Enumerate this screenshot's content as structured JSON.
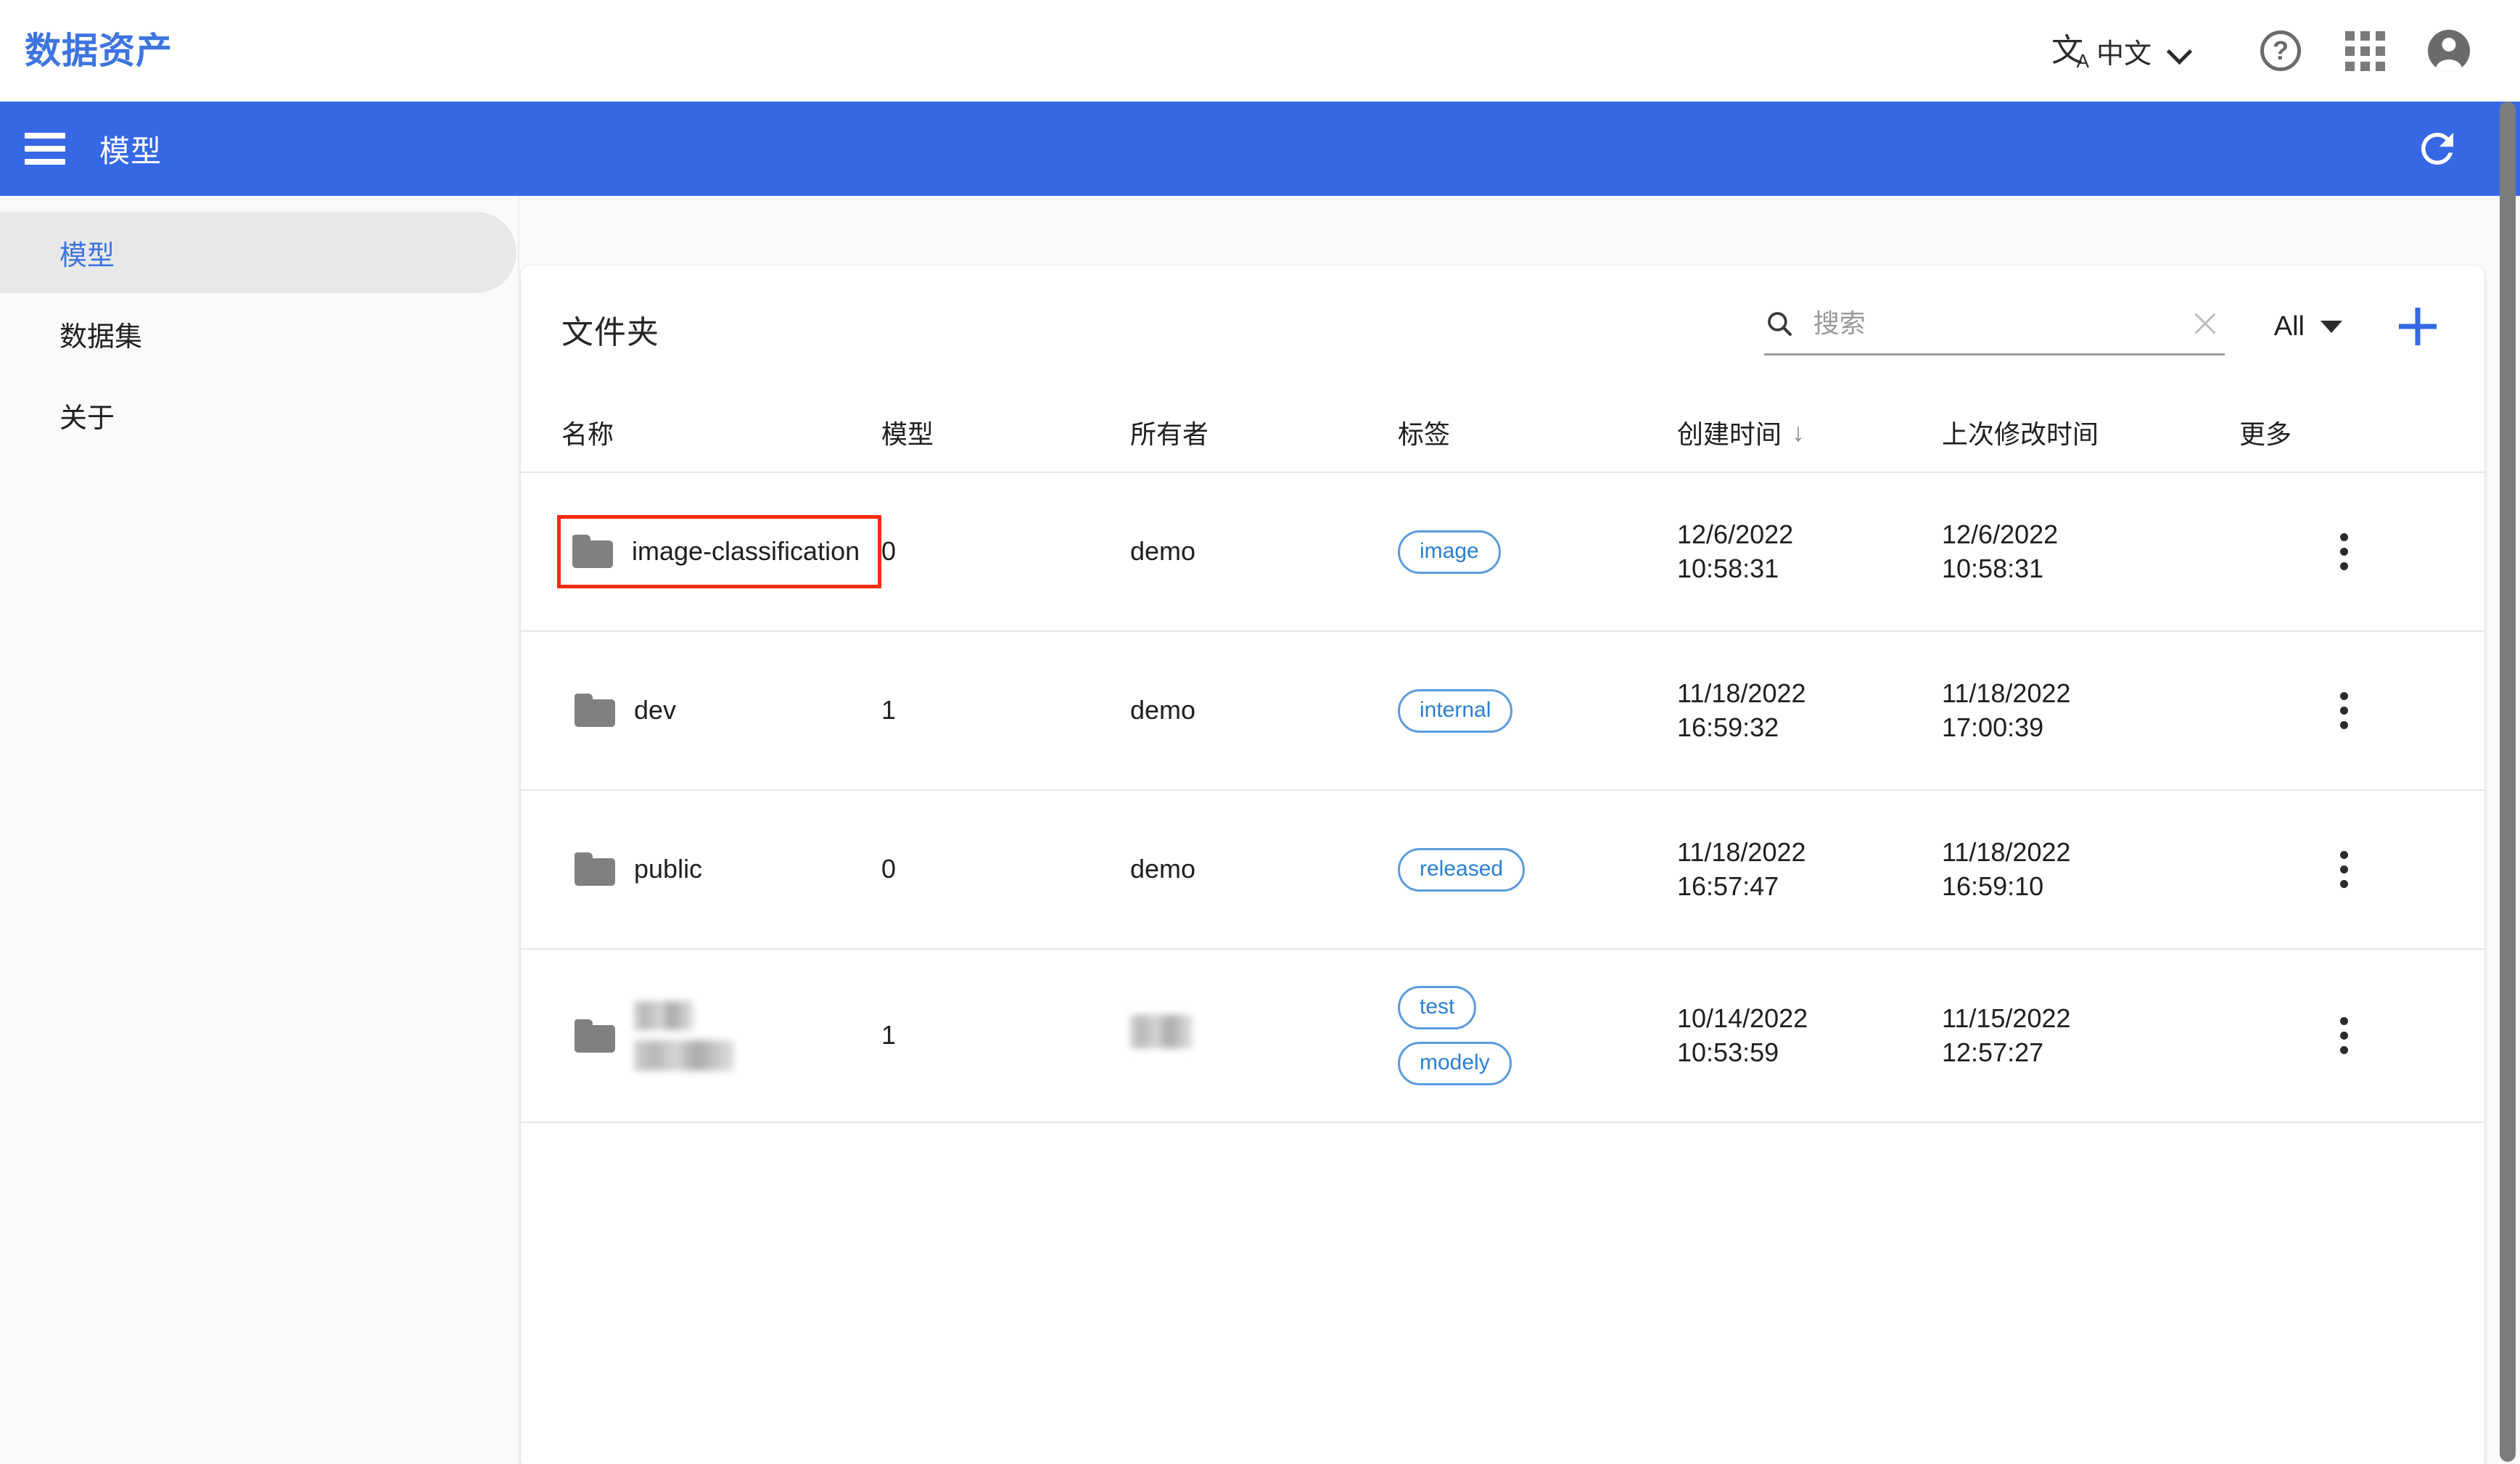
{
  "topbar": {
    "title": "数据资产",
    "language_label": "中文",
    "translate_icon": "translate-icon",
    "chevron_icon": "chevron-down-icon",
    "help_icon": "help-circle-icon",
    "help_glyph": "?",
    "apps_icon": "apps-grid-icon",
    "account_icon": "account-circle-icon"
  },
  "bluebar": {
    "menu_icon": "hamburger-menu-icon",
    "title": "模型",
    "refresh_icon": "refresh-icon",
    "background_color": "#3668e6"
  },
  "sidebar": {
    "items": [
      {
        "label": "模型",
        "active": true
      },
      {
        "label": "数据集",
        "active": false
      },
      {
        "label": "关于",
        "active": false
      }
    ],
    "active_color": "#3d74e0"
  },
  "card": {
    "title": "文件夹",
    "search": {
      "icon": "search-icon",
      "value": "",
      "placeholder": "搜索",
      "clear_icon": "clear-x-icon"
    },
    "filter": {
      "label": "All",
      "icon": "triangle-down-icon"
    },
    "add_button": {
      "icon": "plus-icon",
      "color": "#3668e6"
    }
  },
  "table": {
    "headers": [
      {
        "label": "名称"
      },
      {
        "label": "模型"
      },
      {
        "label": "所有者"
      },
      {
        "label": "标签"
      },
      {
        "label": "创建时间",
        "sort": "↓"
      },
      {
        "label": "上次修改时间"
      },
      {
        "label": "更多"
      }
    ],
    "rows": [
      {
        "name": "image-classification",
        "name_redacted": false,
        "highlighted": true,
        "models": "0",
        "owner": "demo",
        "owner_redacted": false,
        "tags": [
          "image"
        ],
        "created_date": "12/6/2022",
        "created_time": "10:58:31",
        "modified_date": "12/6/2022",
        "modified_time": "10:58:31",
        "more_icon": "kebab-menu-icon"
      },
      {
        "name": "dev",
        "name_redacted": false,
        "highlighted": false,
        "models": "1",
        "owner": "demo",
        "owner_redacted": false,
        "tags": [
          "internal"
        ],
        "created_date": "11/18/2022",
        "created_time": "16:59:32",
        "modified_date": "11/18/2022",
        "modified_time": "17:00:39",
        "more_icon": "kebab-menu-icon"
      },
      {
        "name": "public",
        "name_redacted": false,
        "highlighted": false,
        "models": "0",
        "owner": "demo",
        "owner_redacted": false,
        "tags": [
          "released"
        ],
        "created_date": "11/18/2022",
        "created_time": "16:57:47",
        "modified_date": "11/18/2022",
        "modified_time": "16:59:10",
        "more_icon": "kebab-menu-icon"
      },
      {
        "name": "",
        "name_redacted": true,
        "highlighted": false,
        "models": "1",
        "owner": "",
        "owner_redacted": true,
        "tags": [
          "test",
          "modely"
        ],
        "created_date": "10/14/2022",
        "created_time": "10:53:59",
        "modified_date": "11/15/2022",
        "modified_time": "12:57:27",
        "more_icon": "kebab-menu-icon"
      }
    ]
  },
  "annotation": {
    "highlight_color": "#fa2a0e"
  },
  "scrollbar": {
    "name": "vertical-scrollbar"
  }
}
